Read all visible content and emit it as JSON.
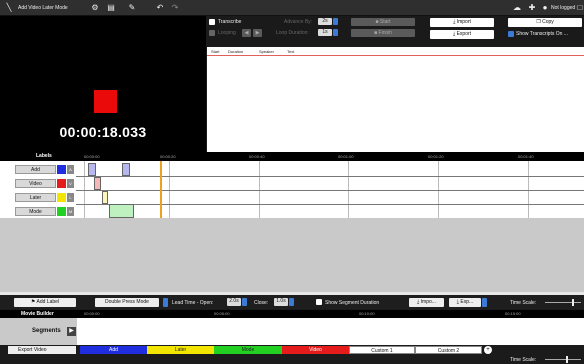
{
  "app": {
    "mode_label": "Add Video Later Mode",
    "login_label": "Not logged in"
  },
  "video": {
    "timecode": "00:00:18.033"
  },
  "transcript": {
    "transcribe_label": "Transcribe",
    "advance_by_label": "Advance By:",
    "advance_by_value": "2s",
    "looping_label": "Looping",
    "loop_duration_label": "Loop Duration:",
    "loop_duration_value": "1s",
    "start_label": "Start",
    "finish_label": "Finish",
    "import_label": "Import",
    "export_label": "Export",
    "copy_label": "Copy",
    "show_transcripts_label": "Show Transcripts On ...",
    "columns": [
      "Start",
      "Duration",
      "Speaker",
      "Text"
    ]
  },
  "timeline": {
    "labels_header": "Labels",
    "ticks": [
      "00:00:00",
      "00:00:20",
      "00:00:40",
      "00:01:00",
      "00:01:20",
      "00:01:40"
    ],
    "rows": [
      {
        "label": "Add",
        "key": "A",
        "color": "#1f2fe0"
      },
      {
        "label": "Video",
        "key": "V",
        "color": "#e61b1b"
      },
      {
        "label": "Later",
        "key": "L",
        "color": "#f2e600"
      },
      {
        "label": "Mode",
        "key": "M",
        "color": "#22d022"
      }
    ],
    "playhead_color": "#f0a020"
  },
  "bottom_toolbar": {
    "add_label": "Add Label",
    "press_mode": "Double Press Mode",
    "lead_time_label": "Lead Time - Open:",
    "lead_time_value": "2.0s",
    "close_label": "Close:",
    "close_value": "1.0s",
    "show_segment_duration_label": "Show Segment Duration",
    "import_label": "Impo...",
    "export_label": "Exp...",
    "time_scale_label": "Time Scale:"
  },
  "movie_builder": {
    "title": "Movie Builder",
    "segments_label": "Segments",
    "export_label": "Export Video",
    "ticks": [
      "00:00:00",
      "00:05:00",
      "00:10:00",
      "00:15:00"
    ],
    "tracks": [
      {
        "label": "Add",
        "bg": "#1f2fe0",
        "fg": "#ffffff"
      },
      {
        "label": "Later",
        "bg": "#f2e600",
        "fg": "#222222"
      },
      {
        "label": "Mode",
        "bg": "#22d022",
        "fg": "#222222"
      },
      {
        "label": "Video",
        "bg": "#e61b1b",
        "fg": "#ffffff"
      },
      {
        "label": "Custom 1",
        "bg": "#ffffff",
        "fg": "#111111"
      },
      {
        "label": "Custom 2",
        "bg": "#ffffff",
        "fg": "#111111"
      }
    ],
    "time_scale_label": "Time Scale:"
  }
}
